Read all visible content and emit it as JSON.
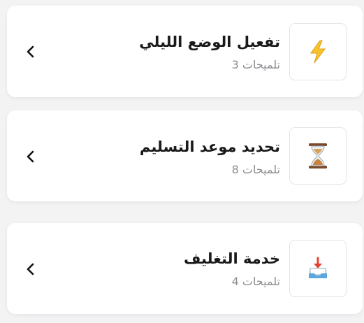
{
  "items": [
    {
      "title": "تفعيل الوضع الليلي",
      "subtitle": "3 تلميحات",
      "icon": "lightning-icon"
    },
    {
      "title": "تحديد موعد التسليم",
      "subtitle": "8 تلميحات",
      "icon": "hourglass-icon"
    },
    {
      "title": "خدمة التغليف",
      "subtitle": "4 تلميحات",
      "icon": "inbox-tray-icon"
    }
  ]
}
